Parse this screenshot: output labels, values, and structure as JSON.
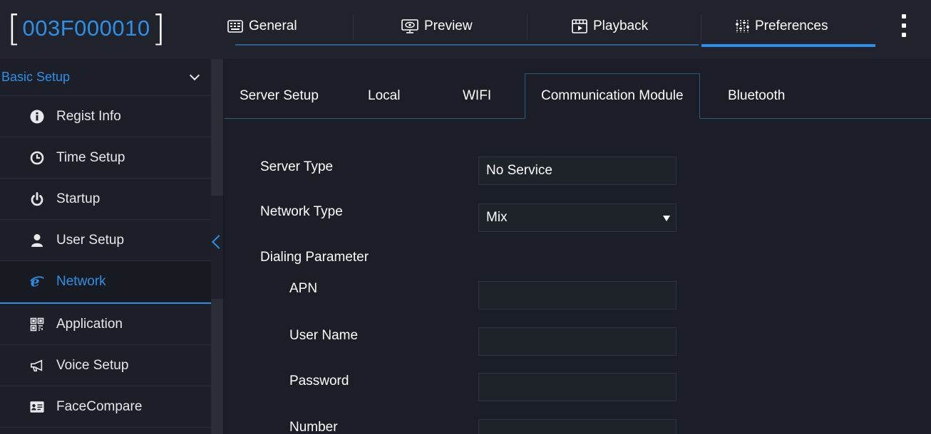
{
  "device": {
    "id": "003F000010"
  },
  "top_tabs": [
    {
      "label": "General",
      "icon": "keyboard-icon"
    },
    {
      "label": "Preview",
      "icon": "monitor-eye-icon"
    },
    {
      "label": "Playback",
      "icon": "film-playback-icon"
    },
    {
      "label": "Preferences",
      "icon": "sliders-icon",
      "active": true
    }
  ],
  "sidebar": {
    "section": "Basic Setup",
    "items": [
      {
        "label": "Regist Info",
        "icon": "info-circle-icon"
      },
      {
        "label": "Time Setup",
        "icon": "clock-icon"
      },
      {
        "label": "Startup",
        "icon": "power-icon"
      },
      {
        "label": "User Setup",
        "icon": "user-icon"
      },
      {
        "label": "Network",
        "icon": "internet-e-icon",
        "active": true
      },
      {
        "label": "Application",
        "icon": "qr-code-icon"
      },
      {
        "label": "Voice Setup",
        "icon": "megaphone-icon"
      },
      {
        "label": "FaceCompare",
        "icon": "id-card-icon"
      }
    ]
  },
  "sub_tabs": [
    {
      "label": "Server Setup"
    },
    {
      "label": "Local"
    },
    {
      "label": "WIFI"
    },
    {
      "label": "Communication Module",
      "active": true
    },
    {
      "label": "Bluetooth"
    }
  ],
  "form": {
    "server_type": {
      "label": "Server Type",
      "value": "No Service"
    },
    "network_type": {
      "label": "Network Type",
      "value": "Mix"
    },
    "dialing_parameter": {
      "label": "Dialing Parameter"
    },
    "apn": {
      "label": "APN",
      "value": ""
    },
    "user_name": {
      "label": "User Name",
      "value": ""
    },
    "password": {
      "label": "Password",
      "value": ""
    },
    "number": {
      "label": "Number",
      "value": ""
    }
  },
  "colors": {
    "accent": "#2e8fe6",
    "background": "#1b1e26",
    "topbar": "#20232b"
  }
}
